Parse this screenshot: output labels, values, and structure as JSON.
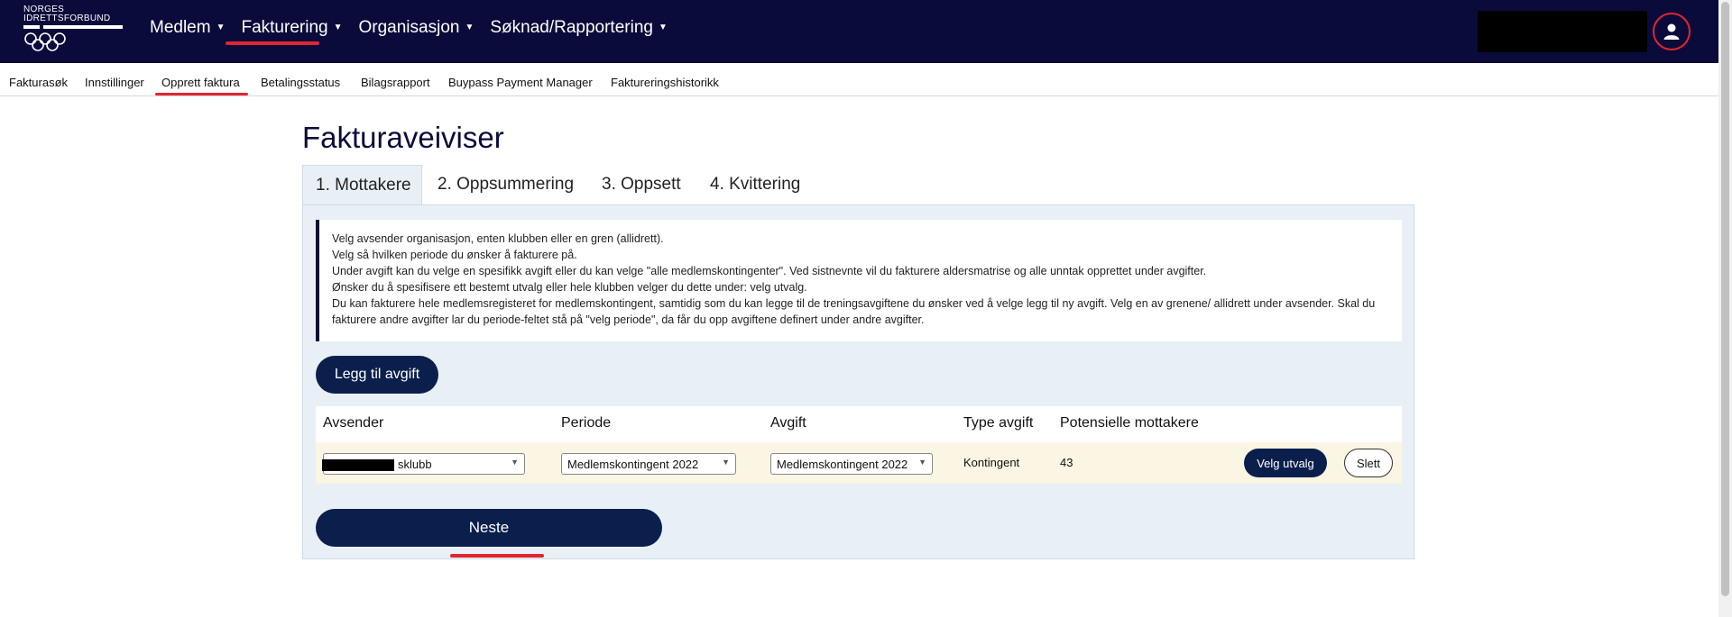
{
  "brand": {
    "logo_line1": "NORGES",
    "logo_line2": "IDRETTSFORBUND"
  },
  "topnav": {
    "items": [
      {
        "label": "Medlem"
      },
      {
        "label": "Fakturering"
      },
      {
        "label": "Organisasjon"
      },
      {
        "label": "Søknad/Rapportering"
      }
    ]
  },
  "subnav": {
    "items": [
      {
        "label": "Fakturasøk"
      },
      {
        "label": "Innstillinger"
      },
      {
        "label": "Opprett faktura"
      },
      {
        "label": "Betalingsstatus"
      },
      {
        "label": "Bilagsrapport"
      },
      {
        "label": "Buypass Payment Manager"
      },
      {
        "label": "Faktureringshistorikk"
      }
    ]
  },
  "page": {
    "title": "Fakturaveiviser"
  },
  "tabs": [
    {
      "label": "1. Mottakere"
    },
    {
      "label": "2. Oppsummering"
    },
    {
      "label": "3. Oppsett"
    },
    {
      "label": "4. Kvittering"
    }
  ],
  "info": {
    "lines": [
      "Velg avsender organisasjon, enten klubben eller en gren (allidrett).",
      "Velg så hvilken periode du ønsker å fakturere på.",
      "Under avgift kan du velge en spesifikk avgift eller du kan velge \"alle medlemskontingenter\". Ved sistnevnte vil du fakturere aldersmatrise og alle unntak opprettet under avgifter.",
      "Ønsker du å spesifisere ett bestemt utvalg eller hele klubben velger du dette under: velg utvalg.",
      "Du kan fakturere hele medlemsregisteret for medlemskontingent, samtidig som du kan legge til de treningsavgiftene du ønsker ved å velge legg til ny avgift. Velg en av grenene/ allidrett under avsender. Skal du fakturere andre avgifter lar du periode-feltet stå på \"velg periode\", da får du opp avgiftene definert under andre avgifter."
    ]
  },
  "buttons": {
    "add_fee": "Legg til avgift",
    "select": "Velg utvalg",
    "delete": "Slett",
    "next": "Neste"
  },
  "table": {
    "headers": [
      "Avsender",
      "Periode",
      "Avgift",
      "Type avgift",
      "Potensielle mottakere"
    ],
    "row": {
      "sender": "sklubb",
      "period": "Medlemskontingent 2022",
      "fee": "Medlemskontingent 2022",
      "fee_type": "Kontingent",
      "recipients": "43"
    }
  },
  "colors": {
    "nav_bg": "#0b0b3b",
    "accent_red": "#e0262f",
    "button_navy": "#0b1f4d",
    "panel_bg": "#e8f0f6",
    "row_bg": "#fbf5e3"
  }
}
